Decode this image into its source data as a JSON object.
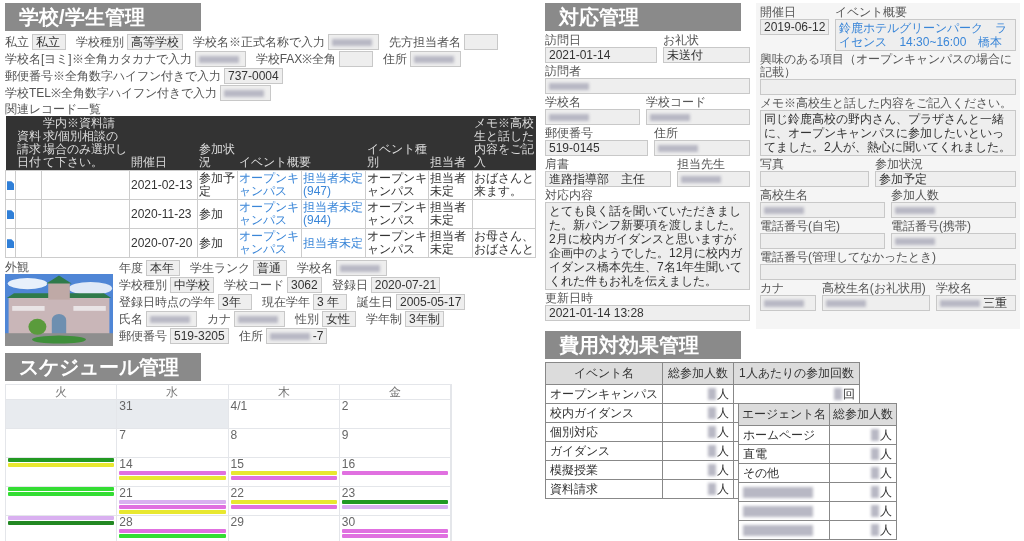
{
  "school_student": {
    "title": "学校/学生管理",
    "school_rows": [
      [
        {
          "label": "私立",
          "value": "私立"
        },
        {
          "label": "学校種別",
          "value": "高等学校"
        },
        {
          "label": "学校名※正式名称で入力",
          "redacted": true
        },
        {
          "label": "先方担当者名"
        }
      ],
      [
        {
          "label": "学校名[ヨミ]※全角カタカナで入力",
          "redacted": true
        },
        {
          "label": "学校FAX※全角"
        },
        {
          "label": "住所",
          "redacted": true
        }
      ],
      [
        {
          "label": "郵便番号※全角数字ハイフン付きで入力",
          "value": "737-0004"
        }
      ],
      [
        {
          "label": "学校TEL※全角数字ハイフン付きで入力",
          "redacted": true
        }
      ]
    ],
    "records": {
      "title": "関連レコード一覧",
      "columns": [
        "資料請求日付",
        "学内※資料請求/個別相談の場合のみ選択して下さい。",
        "開催日",
        "参加状況",
        "イベント概要",
        "イベント種別",
        "担当者",
        "メモ※高校生と話した内容をご記入"
      ],
      "rows": [
        {
          "date": "2021-02-13",
          "status": "参加予定",
          "event": "オープンキャンパス",
          "event_detail": "担当者未定(947)",
          "event_type": "オープンキャンパス",
          "staff": "担当者未定",
          "memo": "おばさんと来ます。"
        },
        {
          "date": "2020-11-23",
          "status": "参加",
          "event": "オープンキャンパス",
          "event_detail": "担当者未定(944)",
          "event_type": "オープンキャンパス",
          "staff": "担当者未定",
          "memo": ""
        },
        {
          "date": "2020-07-20",
          "status": "参加",
          "event": "オープンキャンパス",
          "event_detail": "担当者未定",
          "event_type": "オープンキャンパス",
          "staff": "担当者未定",
          "memo": "お母さん、おばさんと"
        }
      ]
    },
    "exterior": {
      "label": "外観",
      "kind": "picture"
    },
    "student_rows": [
      [
        {
          "label": "年度",
          "value": "本年"
        },
        {
          "label": "学生ランク",
          "value": "普通"
        },
        {
          "label": "学校名",
          "redacted": true
        }
      ],
      [
        {
          "label": "学校種別",
          "value": "中学校"
        },
        {
          "label": "学校コード",
          "value": "3062"
        },
        {
          "label": "登録日",
          "value": "2020-07-21"
        }
      ],
      [
        {
          "label": "登録日時点の学年",
          "value": "3年"
        },
        {
          "label": "現在学年",
          "value": "3 年"
        },
        {
          "label": "誕生日",
          "value": "2005-05-17"
        }
      ],
      [
        {
          "label": "氏名",
          "redacted": true
        },
        {
          "label": "カナ",
          "redacted": true
        },
        {
          "label": "性別",
          "value": "女性"
        },
        {
          "label": "学年制",
          "value": "3年制"
        }
      ],
      [
        {
          "label": "郵便番号",
          "value": "519-3205"
        },
        {
          "label": "住所",
          "value": "-7",
          "redacted": true
        }
      ]
    ]
  },
  "response": {
    "title": "対応管理",
    "rows": [
      [
        {
          "label": "訪問日",
          "value": "2021-01-14"
        },
        {
          "label": "お礼状",
          "value": "未送付"
        }
      ],
      [
        {
          "label": "訪問者",
          "redacted": true
        }
      ],
      [
        {
          "label": "学校名",
          "redacted": true
        },
        {
          "label": "学校コード",
          "redacted": true
        }
      ],
      [
        {
          "label": "郵便番号",
          "value": "519-0145"
        },
        {
          "label": "住所",
          "redacted": true
        }
      ],
      [
        {
          "label": "肩書",
          "value": "進路指導部　主任"
        },
        {
          "label": "担当先生",
          "redacted": true
        }
      ],
      [
        {
          "label": "対応内容",
          "text": "とても良く話を聞いていただきました。新パンフ新要項を渡しました。2月に校内ガイダンスと思いますが企画中のようでした。12月に校内ガイダンス橋本先生、7名1年生聞いてくれた件もお礼を伝えました。"
        }
      ],
      [
        {
          "label": "更新日時",
          "value": "2021-01-14 13:28"
        }
      ]
    ],
    "event_panel": [
      [
        {
          "label": "開催日",
          "value": "2019-06-12"
        },
        {
          "label": "イベント概要",
          "text": "鈴鹿ホテルグリーンパーク　ライセンス　14:30~16:00　橋本",
          "link": true
        }
      ],
      [
        {
          "label": "興味のある項目（オープンキャンパスの場合に記載）"
        }
      ],
      [
        {
          "label": "メモ※高校生と話した内容をご記入ください。",
          "text": "同じ鈴鹿高校の野内さん、プラザさんと一緒に、オープンキャンパスに参加したいといってました。2人が、熱心に聞いてくれました。"
        }
      ],
      [
        {
          "label": "写真"
        },
        {
          "label": "参加状況",
          "value": "参加予定"
        }
      ],
      [
        {
          "label": "高校生名",
          "redacted": true
        },
        {
          "label": "参加人数",
          "redacted": true
        }
      ],
      [
        {
          "label": "電話番号(自宅)"
        },
        {
          "label": "電話番号(携帯)",
          "redacted": true
        }
      ],
      [
        {
          "label": "電話番号(管理してなかったとき)"
        }
      ],
      [
        {
          "label": "カナ",
          "redacted": true
        },
        {
          "label": "高校生名(お礼状用)",
          "redacted": true
        },
        {
          "label": "学校名",
          "value": "三重",
          "redacted": true
        }
      ]
    ]
  },
  "schedule": {
    "title": "スケジュール管理",
    "weekdays": [
      "火",
      "水",
      "木",
      "金"
    ],
    "weeks": [
      [
        {
          "outside": true
        },
        {
          "date": "31",
          "outside": true
        },
        {
          "date": "4/1",
          "outside": false
        },
        {
          "date": "2",
          "outside": false
        }
      ],
      [
        {
          "outside": false
        },
        {
          "date": "7",
          "outside": false
        },
        {
          "date": "8",
          "outside": false
        },
        {
          "date": "9",
          "outside": false
        }
      ],
      [
        {
          "outside": false,
          "events": [
            {
              "color": "#229922"
            },
            {
              "color": "#e8e830"
            }
          ]
        },
        {
          "date": "14",
          "outside": false,
          "events": [
            {
              "color": "#e070e0"
            },
            {
              "color": "#e8e830"
            }
          ]
        },
        {
          "date": "15",
          "outside": false,
          "events": [
            {
              "color": "#e8e830"
            },
            {
              "color": "#e070e0"
            }
          ]
        },
        {
          "date": "16",
          "outside": false,
          "events": [
            {
              "color": "#e070e0"
            }
          ]
        }
      ],
      [
        {
          "outside": false,
          "events": [
            {
              "color": "#33dd33"
            },
            {
              "color": "#33dd33"
            }
          ]
        },
        {
          "date": "21",
          "outside": false,
          "events": [
            {
              "color": "#d9b0f0"
            },
            {
              "color": "#e070e0"
            },
            {
              "color": "#e8e830"
            }
          ]
        },
        {
          "date": "22",
          "outside": false,
          "events": [
            {
              "color": "#e8e830"
            },
            {
              "color": "#e070e0"
            }
          ]
        },
        {
          "date": "23",
          "outside": false,
          "events": [
            {
              "color": "#229922"
            },
            {
              "color": "#d9b0f0"
            }
          ]
        }
      ],
      [
        {
          "outside": false,
          "events": [
            {
              "color": "#d9b0f0"
            },
            {
              "color": "#228822"
            }
          ]
        },
        {
          "date": "28",
          "outside": false,
          "events": [
            {
              "color": "#e070e0"
            },
            {
              "color": "#33dd33"
            }
          ]
        },
        {
          "date": "29",
          "outside": false
        },
        {
          "date": "30",
          "outside": false,
          "events": [
            {
              "color": "#e070e0"
            },
            {
              "color": "#e070e0"
            }
          ]
        }
      ]
    ]
  },
  "cost": {
    "title": "費用対効果管理",
    "events_table": {
      "columns": [
        "イベント名",
        "総参加人数",
        "1人あたりの参加回数"
      ],
      "rows": [
        {
          "name": "オープンキャンパス",
          "count": "人",
          "per_person": "回"
        },
        {
          "name": "校内ガイダンス",
          "count": "人"
        },
        {
          "name": "個別対応",
          "count": "人"
        },
        {
          "name": "ガイダンス",
          "count": "人"
        },
        {
          "name": "模擬授業",
          "count": "人"
        },
        {
          "name": "資料請求",
          "count": "人"
        }
      ]
    },
    "agents_table": {
      "columns": [
        "エージェント名",
        "総参加人数"
      ],
      "rows": [
        {
          "name": "ホームページ",
          "count": "人"
        },
        {
          "name": "直電",
          "count": "人"
        },
        {
          "name": "その他",
          "count": "人"
        },
        {
          "redacted": true,
          "count": "人"
        },
        {
          "redacted": true,
          "count": "人"
        },
        {
          "redacted": true,
          "count": "人"
        }
      ]
    }
  }
}
